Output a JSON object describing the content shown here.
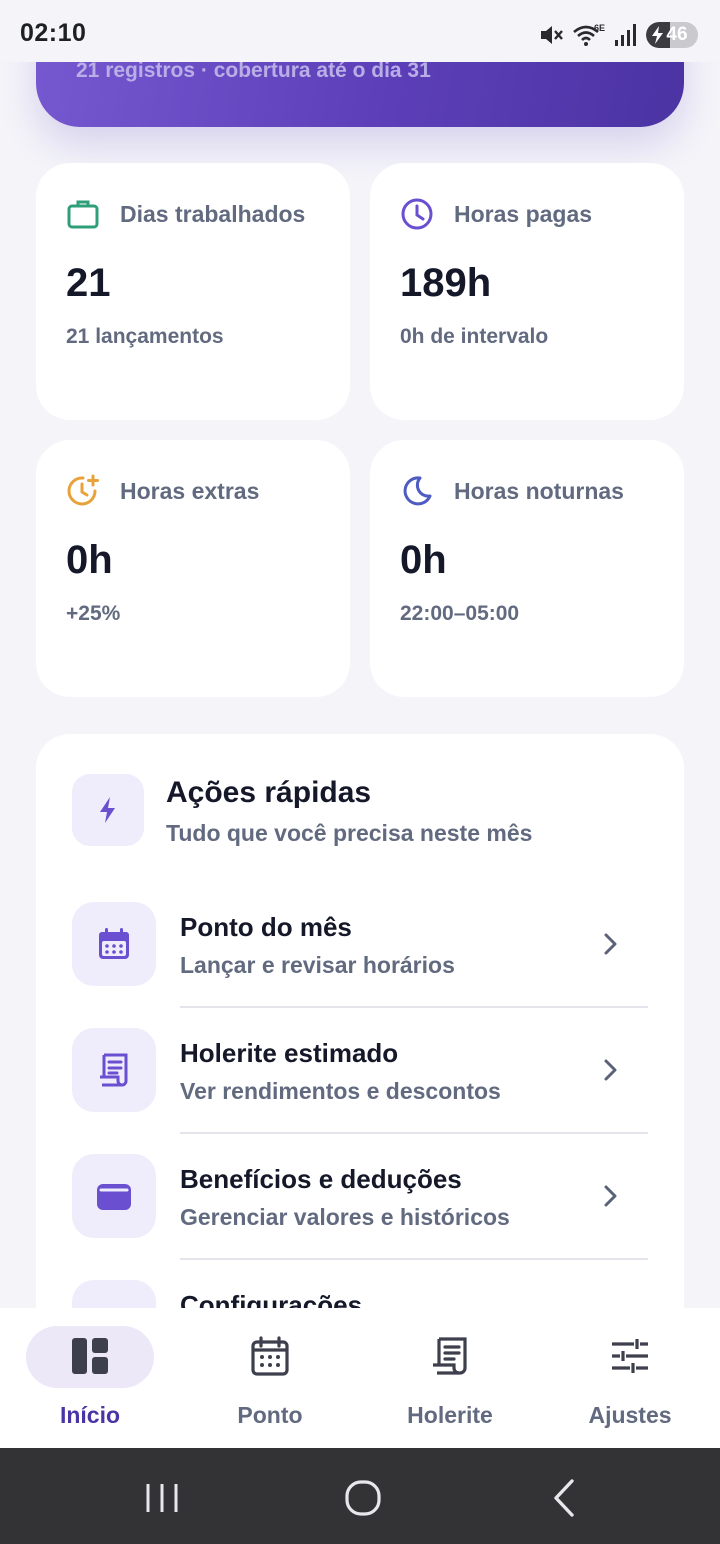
{
  "status_bar": {
    "time": "02:10",
    "battery": "46",
    "icons": [
      "mute-icon",
      "wifi-6e-icon",
      "signal-icon",
      "battery-charging-icon"
    ]
  },
  "hero": {
    "subtitle": "21 registros · cobertura até o dia 31"
  },
  "stats": [
    {
      "icon": "briefcase-icon",
      "color": "#2e9f79",
      "label": "Dias trabalhados",
      "value": "21",
      "sub": "21 lançamentos"
    },
    {
      "icon": "clock-icon",
      "color": "#6a4fd0",
      "label": "Horas pagas",
      "value": "189h",
      "sub": "0h de intervalo"
    },
    {
      "icon": "clock-plus-icon",
      "color": "#e9a23b",
      "label": "Horas extras",
      "value": "0h",
      "sub": "+25%"
    },
    {
      "icon": "moon-icon",
      "color": "#4d5bc2",
      "label": "Horas noturnas",
      "value": "0h",
      "sub": "22:00–05:00"
    }
  ],
  "quick_actions": {
    "title": "Ações rápidas",
    "subtitle": "Tudo que você precisa neste mês",
    "items": [
      {
        "icon": "calendar-icon",
        "title": "Ponto do mês",
        "sub": "Lançar e revisar horários"
      },
      {
        "icon": "receipt-icon",
        "title": "Holerite estimado",
        "sub": "Ver rendimentos e descontos"
      },
      {
        "icon": "wallet-icon",
        "title": "Benefícios e deduções",
        "sub": "Gerenciar valores e históricos"
      },
      {
        "icon": "settings-icon",
        "title": "Configurações",
        "sub": ""
      }
    ]
  },
  "nav": {
    "items": [
      {
        "label": "Início",
        "icon": "dashboard-icon",
        "active": true
      },
      {
        "label": "Ponto",
        "icon": "calendar-icon",
        "active": false
      },
      {
        "label": "Holerite",
        "icon": "receipt-icon",
        "active": false
      },
      {
        "label": "Ajustes",
        "icon": "sliders-icon",
        "active": false
      }
    ]
  },
  "colors": {
    "accent": "#5c3fb8",
    "accent_light": "#efecfb",
    "text_dark": "#141829",
    "text_muted": "#626a80"
  }
}
